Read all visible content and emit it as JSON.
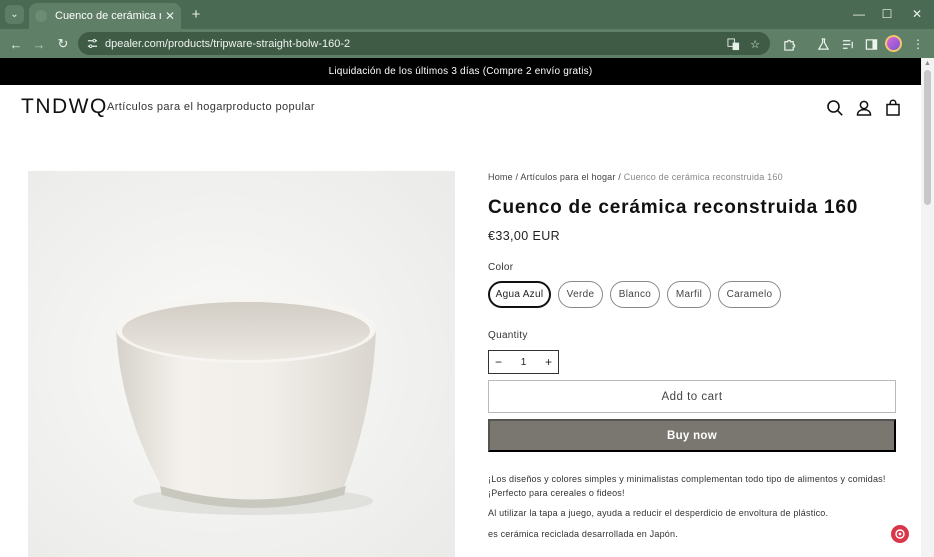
{
  "browser": {
    "tab_title": "Cuenco de cerámica reconstrui",
    "tab_close": "✕",
    "new_tab": "+",
    "url": "dpealer.com/products/tripware-straight-bolw-160-2",
    "window_controls": {
      "minimize": "—",
      "maximize": "☐",
      "close": "✕"
    },
    "nav": {
      "back": "←",
      "forward": "→",
      "reload": "↻"
    }
  },
  "store": {
    "announcement": "Liquidación de los últimos 3 días (Compre 2 envío gratis)",
    "logo": "TNDWQ",
    "nav": [
      "Artículos para el hogar",
      "producto popular"
    ]
  },
  "product": {
    "breadcrumb": {
      "home": "Home",
      "sep1": " / ",
      "category": "Artículos para el hogar",
      "sep2": " / ",
      "current": "Cuenco de cerámica reconstruida 160"
    },
    "title": "Cuenco de cerámica reconstruida 160",
    "price": "€33,00 EUR",
    "color_label": "Color",
    "colors": [
      "Agua Azul",
      "Verde",
      "Blanco",
      "Marfil",
      "Caramelo"
    ],
    "selected_color": "Agua Azul",
    "quantity_label": "Quantity",
    "quantity": "1",
    "minus": "−",
    "plus": "+",
    "add_to_cart": "Add to cart",
    "buy_now": "Buy now",
    "description": [
      "¡Los diseños y colores simples y minimalistas complementan todo tipo de alimentos y comidas! ¡Perfecto para cereales o fideos!",
      "Al utilizar la tapa a juego, ayuda a reducir el desperdicio de envoltura de plástico.",
      "es cerámica reciclada desarrollada en Japón."
    ]
  },
  "colors": {
    "tabbar": "#4b6a53",
    "toolbar": "#5f7f67",
    "announcement_bg": "#000000",
    "buy_now_bg": "#7a7670",
    "chat_badge": "#d9364a"
  }
}
